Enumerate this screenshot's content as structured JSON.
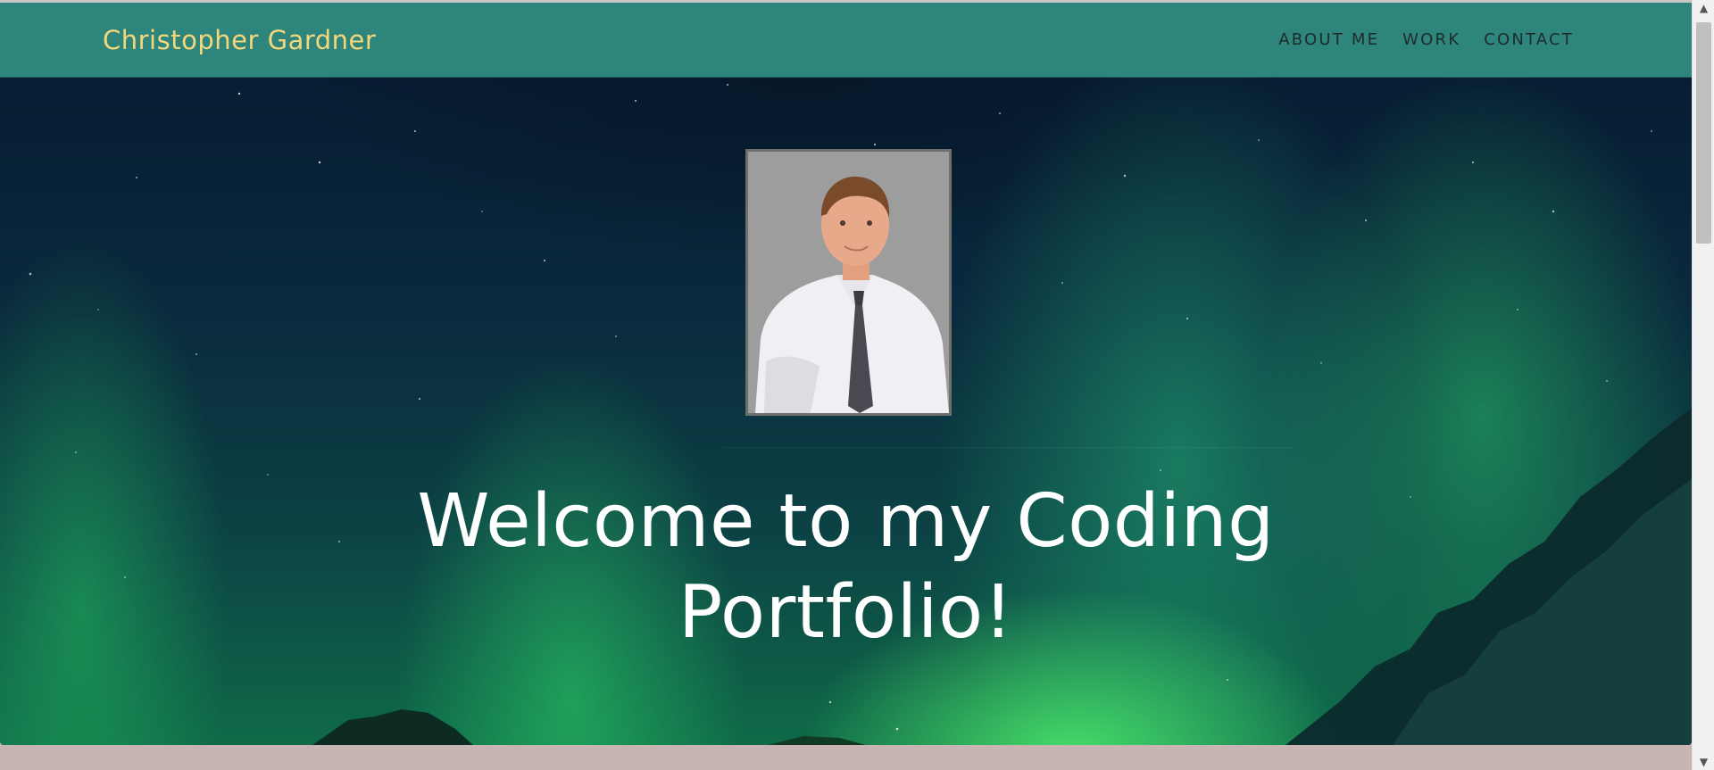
{
  "header": {
    "brand": "Christopher Gardner",
    "nav": [
      {
        "label": "ABOUT ME"
      },
      {
        "label": "WORK"
      },
      {
        "label": "CONTACT"
      }
    ]
  },
  "hero": {
    "title": "Welcome to my Coding Portfolio!",
    "portrait_icon": "portrait-photo"
  },
  "scrollbar": {
    "up_icon": "chevron-up-icon",
    "down_icon": "chevron-down-icon"
  },
  "colors": {
    "navbar": "#2d857c",
    "brand": "#f4d77a",
    "nav_text": "#1e2b2a",
    "footer_strip": "#c9b4b4",
    "aurora_green": "#2fd36b"
  }
}
